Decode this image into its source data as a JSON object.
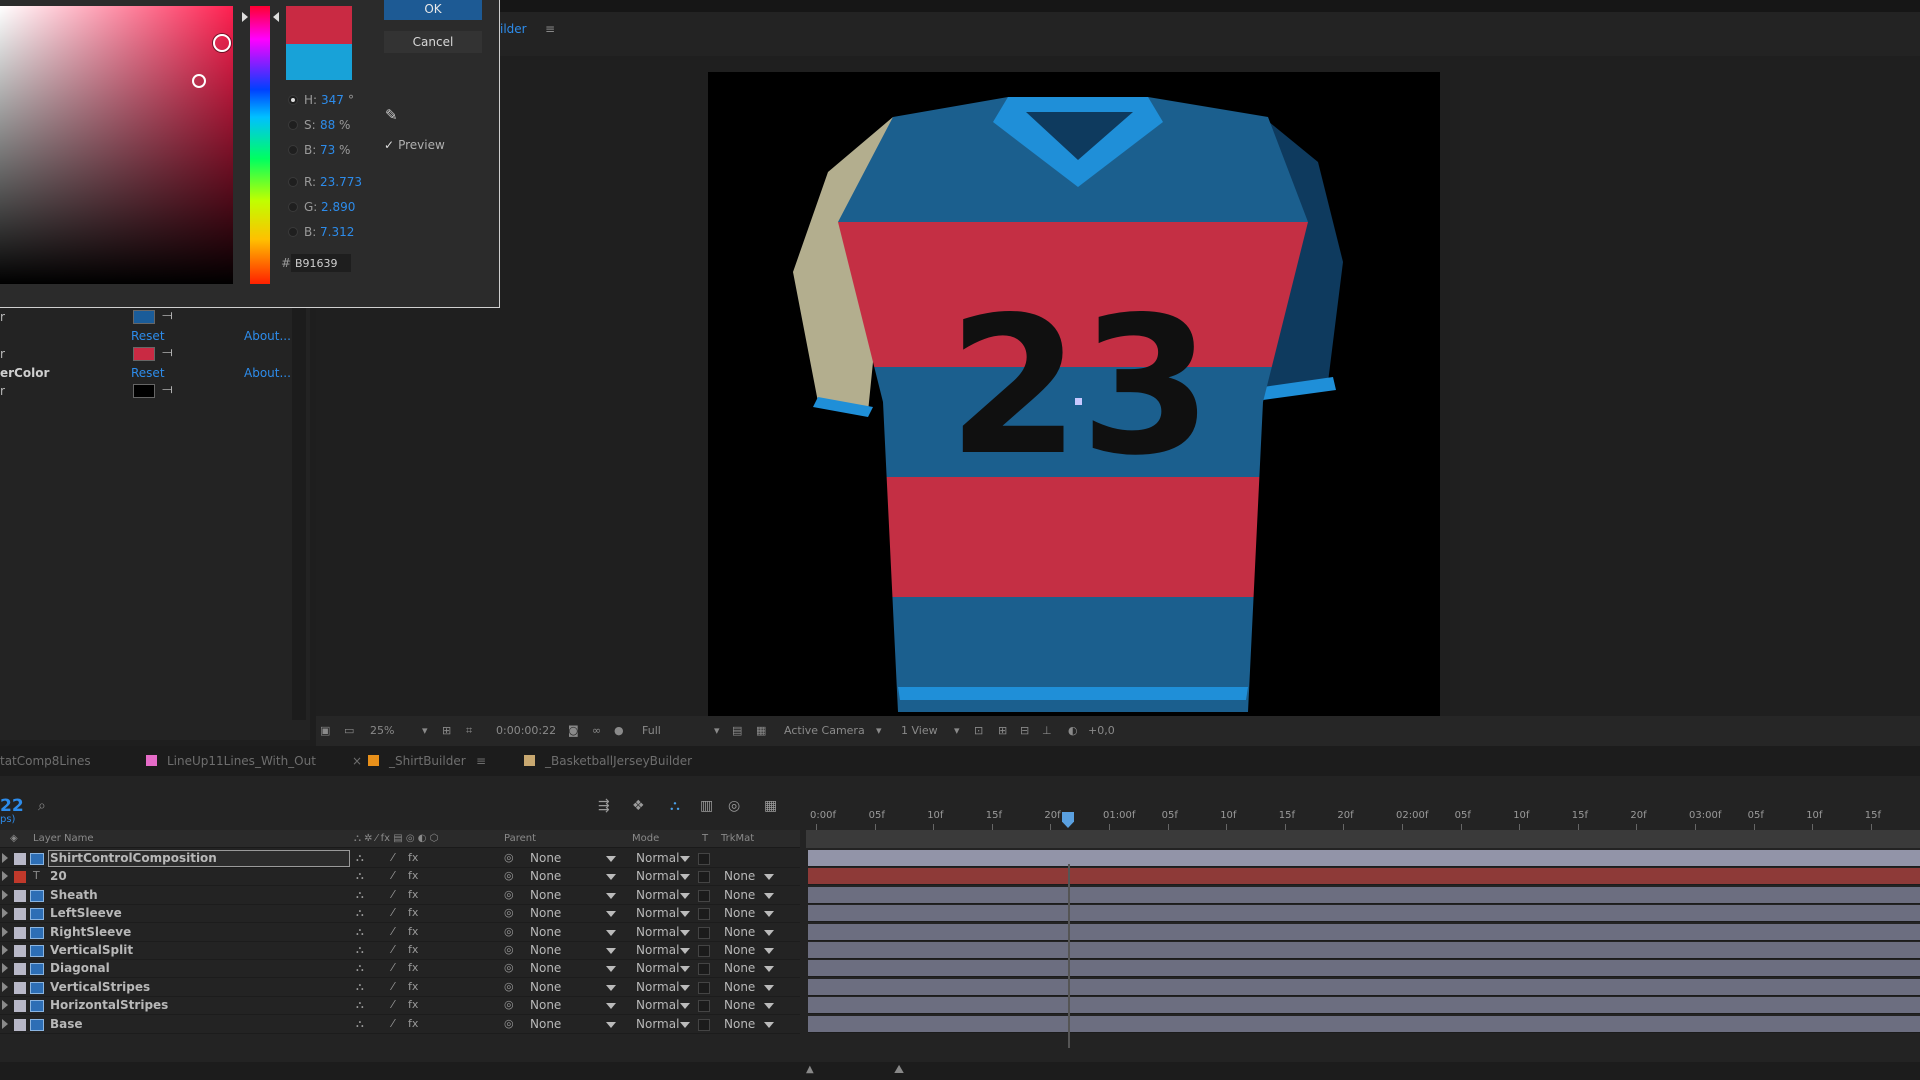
{
  "color_picker": {
    "ok_label": "OK",
    "cancel_label": "Cancel",
    "preview_label": "Preview",
    "hex_symbol": "#",
    "hex_value": "B91639",
    "new_color": "#c92a43",
    "old_color": "#18a2d8",
    "components": [
      {
        "label": "H:",
        "value": "347",
        "unit": "°",
        "selected": true
      },
      {
        "label": "S:",
        "value": "88",
        "unit": "%",
        "selected": false
      },
      {
        "label": "B:",
        "value": "73",
        "unit": "%",
        "selected": false
      },
      {
        "label": "R:",
        "value": "23.773",
        "unit": "",
        "selected": false
      },
      {
        "label": "G:",
        "value": "2.890",
        "unit": "",
        "selected": false
      },
      {
        "label": "B:",
        "value": "7.312",
        "unit": "",
        "selected": false
      }
    ]
  },
  "effect_controls": {
    "rows": [
      {
        "label": "r",
        "swatch": "#1a5c99"
      },
      {
        "label": "",
        "reset": "Reset",
        "about": "About..."
      },
      {
        "label": "r",
        "swatch": "#c92a43"
      },
      {
        "label": "erColor",
        "reset": "Reset",
        "about": "About..."
      },
      {
        "label": "r",
        "swatch": "#000000"
      }
    ]
  },
  "viewer": {
    "tab_label": "ilder",
    "jersey_number": "23",
    "toolbar": {
      "zoom": "25%",
      "timecode": "0:00:00:22",
      "resolution": "Full",
      "camera": "Active Camera",
      "views": "1 View",
      "exposure": "+0,0"
    }
  },
  "timeline_tabs": [
    {
      "label": "tatComp8Lines",
      "color": ""
    },
    {
      "label": "LineUp11Lines_With_Out",
      "color": "#e66cc8"
    },
    {
      "label": "_ShirtBuilder",
      "color": "#e8901a",
      "active": true
    },
    {
      "label": "_BasketballJerseyBuilder",
      "color": "#c8a870"
    }
  ],
  "timeline": {
    "time": "22",
    "fps": "ps)",
    "columns": {
      "layer_name": "Layer Name",
      "parent": "Parent",
      "mode": "Mode",
      "t": "T",
      "trkmat": "TrkMat"
    },
    "layers": [
      {
        "name": "ShirtControlComposition",
        "parent": "None",
        "mode": "Normal",
        "trkmat": "",
        "label_color": "#b8b8c8",
        "type": "comp",
        "selected": true
      },
      {
        "name": "20",
        "parent": "None",
        "mode": "Normal",
        "trkmat": "None",
        "label_color": "#c0392b",
        "type": "text"
      },
      {
        "name": "Sheath",
        "parent": "None",
        "mode": "Normal",
        "trkmat": "None",
        "label_color": "#b8b8c8",
        "type": "comp"
      },
      {
        "name": "LeftSleeve",
        "parent": "None",
        "mode": "Normal",
        "trkmat": "None",
        "label_color": "#b8b8c8",
        "type": "comp"
      },
      {
        "name": "RightSleeve",
        "parent": "None",
        "mode": "Normal",
        "trkmat": "None",
        "label_color": "#b8b8c8",
        "type": "comp"
      },
      {
        "name": "VerticalSplit",
        "parent": "None",
        "mode": "Normal",
        "trkmat": "None",
        "label_color": "#b8b8c8",
        "type": "comp"
      },
      {
        "name": "Diagonal",
        "parent": "None",
        "mode": "Normal",
        "trkmat": "None",
        "label_color": "#b8b8c8",
        "type": "comp"
      },
      {
        "name": "VerticalStripes",
        "parent": "None",
        "mode": "Normal",
        "trkmat": "None",
        "label_color": "#b8b8c8",
        "type": "comp"
      },
      {
        "name": "HorizontalStripes",
        "parent": "None",
        "mode": "Normal",
        "trkmat": "None",
        "label_color": "#b8b8c8",
        "type": "comp"
      },
      {
        "name": "Base",
        "parent": "None",
        "mode": "Normal",
        "trkmat": "None",
        "label_color": "#b8b8c8",
        "type": "comp"
      }
    ],
    "ruler_labels": [
      "0:00f",
      "05f",
      "10f",
      "15f",
      "20f",
      "01:00f",
      "05f",
      "10f",
      "15f",
      "20f",
      "02:00f",
      "05f",
      "10f",
      "15f",
      "20f",
      "03:00f",
      "05f",
      "10f",
      "15f"
    ]
  }
}
